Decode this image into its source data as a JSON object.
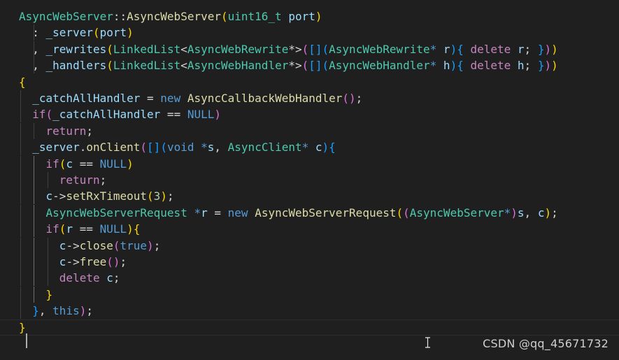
{
  "watermark": "CSDN @qq_45671732",
  "colors": {
    "background": "#1f1f1f",
    "plain": "#d4d4d4",
    "type": "#4ec9b0",
    "function": "#dcdcaa",
    "variable": "#9cdcfe",
    "keyword": "#569cd6",
    "control": "#c586c0",
    "number": "#b5cea8",
    "bracket1": "#ffd700",
    "bracket2": "#da70d6",
    "bracket3": "#179fff"
  },
  "editor": {
    "lines": [
      [
        {
          "t": "AsyncWebServer",
          "c": "type"
        },
        {
          "t": "::",
          "c": "plain"
        },
        {
          "t": "AsyncWebServer",
          "c": "function"
        },
        {
          "t": "(",
          "c": "bracket1"
        },
        {
          "t": "uint16_t",
          "c": "type"
        },
        {
          "t": " ",
          "c": "plain"
        },
        {
          "t": "port",
          "c": "variable"
        },
        {
          "t": ")",
          "c": "bracket1"
        }
      ],
      [
        {
          "t": "  : ",
          "c": "plain"
        },
        {
          "t": "_server",
          "c": "variable"
        },
        {
          "t": "(",
          "c": "bracket1"
        },
        {
          "t": "port",
          "c": "variable"
        },
        {
          "t": ")",
          "c": "bracket1"
        }
      ],
      [
        {
          "t": "  , ",
          "c": "plain"
        },
        {
          "t": "_rewrites",
          "c": "variable"
        },
        {
          "t": "(",
          "c": "bracket1"
        },
        {
          "t": "LinkedList",
          "c": "type"
        },
        {
          "t": "<",
          "c": "plain"
        },
        {
          "t": "AsyncWebRewrite",
          "c": "type"
        },
        {
          "t": "*>",
          "c": "plain"
        },
        {
          "t": "(",
          "c": "bracket2"
        },
        {
          "t": "[]",
          "c": "bracket3"
        },
        {
          "t": "(",
          "c": "bracket3"
        },
        {
          "t": "AsyncWebRewrite",
          "c": "type"
        },
        {
          "t": "*",
          "c": "keyword"
        },
        {
          "t": " r",
          "c": "variable"
        },
        {
          "t": ")",
          "c": "bracket3"
        },
        {
          "t": "{",
          "c": "bracket3"
        },
        {
          "t": " delete",
          "c": "control"
        },
        {
          "t": " r",
          "c": "variable"
        },
        {
          "t": "; ",
          "c": "plain"
        },
        {
          "t": "}",
          "c": "bracket3"
        },
        {
          "t": ")",
          "c": "bracket2"
        },
        {
          "t": ")",
          "c": "bracket1"
        }
      ],
      [
        {
          "t": "  , ",
          "c": "plain"
        },
        {
          "t": "_handlers",
          "c": "variable"
        },
        {
          "t": "(",
          "c": "bracket1"
        },
        {
          "t": "LinkedList",
          "c": "type"
        },
        {
          "t": "<",
          "c": "plain"
        },
        {
          "t": "AsyncWebHandler",
          "c": "type"
        },
        {
          "t": "*>",
          "c": "plain"
        },
        {
          "t": "(",
          "c": "bracket2"
        },
        {
          "t": "[]",
          "c": "bracket3"
        },
        {
          "t": "(",
          "c": "bracket3"
        },
        {
          "t": "AsyncWebHandler",
          "c": "type"
        },
        {
          "t": "*",
          "c": "keyword"
        },
        {
          "t": " h",
          "c": "variable"
        },
        {
          "t": ")",
          "c": "bracket3"
        },
        {
          "t": "{",
          "c": "bracket3"
        },
        {
          "t": " delete",
          "c": "control"
        },
        {
          "t": " h",
          "c": "variable"
        },
        {
          "t": "; ",
          "c": "plain"
        },
        {
          "t": "}",
          "c": "bracket3"
        },
        {
          "t": ")",
          "c": "bracket2"
        },
        {
          "t": ")",
          "c": "bracket1"
        }
      ],
      [
        {
          "t": "{",
          "c": "bracket1"
        }
      ],
      [
        {
          "t": "  ",
          "c": "plain"
        },
        {
          "t": "_catchAllHandler",
          "c": "variable"
        },
        {
          "t": " = ",
          "c": "plain"
        },
        {
          "t": "new",
          "c": "keyword"
        },
        {
          "t": " ",
          "c": "plain"
        },
        {
          "t": "AsyncCallbackWebHandler",
          "c": "function"
        },
        {
          "t": "()",
          "c": "bracket2"
        },
        {
          "t": ";",
          "c": "plain"
        }
      ],
      [
        {
          "t": "  ",
          "c": "plain"
        },
        {
          "t": "if",
          "c": "control"
        },
        {
          "t": "(",
          "c": "bracket2"
        },
        {
          "t": "_catchAllHandler",
          "c": "variable"
        },
        {
          "t": " == ",
          "c": "plain"
        },
        {
          "t": "NULL",
          "c": "keyword"
        },
        {
          "t": ")",
          "c": "bracket2"
        }
      ],
      [
        {
          "t": "    ",
          "c": "plain"
        },
        {
          "t": "return",
          "c": "control"
        },
        {
          "t": ";",
          "c": "plain"
        }
      ],
      [
        {
          "t": "  ",
          "c": "plain"
        },
        {
          "t": "_server",
          "c": "variable"
        },
        {
          "t": ".",
          "c": "plain"
        },
        {
          "t": "onClient",
          "c": "function"
        },
        {
          "t": "(",
          "c": "bracket2"
        },
        {
          "t": "[]",
          "c": "bracket3"
        },
        {
          "t": "(",
          "c": "bracket3"
        },
        {
          "t": "void",
          "c": "keyword"
        },
        {
          "t": " *",
          "c": "keyword"
        },
        {
          "t": "s",
          "c": "variable"
        },
        {
          "t": ", ",
          "c": "plain"
        },
        {
          "t": "AsyncClient",
          "c": "type"
        },
        {
          "t": "*",
          "c": "keyword"
        },
        {
          "t": " c",
          "c": "variable"
        },
        {
          "t": ")",
          "c": "bracket3"
        },
        {
          "t": "{",
          "c": "bracket3"
        }
      ],
      [
        {
          "t": "    ",
          "c": "plain"
        },
        {
          "t": "if",
          "c": "control"
        },
        {
          "t": "(",
          "c": "bracket1"
        },
        {
          "t": "c",
          "c": "variable"
        },
        {
          "t": " == ",
          "c": "plain"
        },
        {
          "t": "NULL",
          "c": "keyword"
        },
        {
          "t": ")",
          "c": "bracket1"
        }
      ],
      [
        {
          "t": "      ",
          "c": "plain"
        },
        {
          "t": "return",
          "c": "control"
        },
        {
          "t": ";",
          "c": "plain"
        }
      ],
      [
        {
          "t": "    ",
          "c": "plain"
        },
        {
          "t": "c",
          "c": "variable"
        },
        {
          "t": "->",
          "c": "plain"
        },
        {
          "t": "setRxTimeout",
          "c": "function"
        },
        {
          "t": "(",
          "c": "bracket1"
        },
        {
          "t": "3",
          "c": "number"
        },
        {
          "t": ")",
          "c": "bracket1"
        },
        {
          "t": ";",
          "c": "plain"
        }
      ],
      [
        {
          "t": "    ",
          "c": "plain"
        },
        {
          "t": "AsyncWebServerRequest",
          "c": "type"
        },
        {
          "t": " *",
          "c": "keyword"
        },
        {
          "t": "r",
          "c": "variable"
        },
        {
          "t": " = ",
          "c": "plain"
        },
        {
          "t": "new",
          "c": "keyword"
        },
        {
          "t": " ",
          "c": "plain"
        },
        {
          "t": "AsyncWebServerRequest",
          "c": "function"
        },
        {
          "t": "(",
          "c": "bracket1"
        },
        {
          "t": "(",
          "c": "bracket2"
        },
        {
          "t": "AsyncWebServer",
          "c": "type"
        },
        {
          "t": "*",
          "c": "keyword"
        },
        {
          "t": ")",
          "c": "bracket2"
        },
        {
          "t": "s",
          "c": "variable"
        },
        {
          "t": ", ",
          "c": "plain"
        },
        {
          "t": "c",
          "c": "variable"
        },
        {
          "t": ")",
          "c": "bracket1"
        },
        {
          "t": ";",
          "c": "plain"
        }
      ],
      [
        {
          "t": "    ",
          "c": "plain"
        },
        {
          "t": "if",
          "c": "control"
        },
        {
          "t": "(",
          "c": "bracket1"
        },
        {
          "t": "r",
          "c": "variable"
        },
        {
          "t": " == ",
          "c": "plain"
        },
        {
          "t": "NULL",
          "c": "keyword"
        },
        {
          "t": ")",
          "c": "bracket1"
        },
        {
          "t": "{",
          "c": "bracket1"
        }
      ],
      [
        {
          "t": "      ",
          "c": "plain"
        },
        {
          "t": "c",
          "c": "variable"
        },
        {
          "t": "->",
          "c": "plain"
        },
        {
          "t": "close",
          "c": "function"
        },
        {
          "t": "(",
          "c": "bracket2"
        },
        {
          "t": "true",
          "c": "keyword"
        },
        {
          "t": ")",
          "c": "bracket2"
        },
        {
          "t": ";",
          "c": "plain"
        }
      ],
      [
        {
          "t": "      ",
          "c": "plain"
        },
        {
          "t": "c",
          "c": "variable"
        },
        {
          "t": "->",
          "c": "plain"
        },
        {
          "t": "free",
          "c": "function"
        },
        {
          "t": "()",
          "c": "bracket2"
        },
        {
          "t": ";",
          "c": "plain"
        }
      ],
      [
        {
          "t": "      ",
          "c": "plain"
        },
        {
          "t": "delete",
          "c": "control"
        },
        {
          "t": " c",
          "c": "variable"
        },
        {
          "t": ";",
          "c": "plain"
        }
      ],
      [
        {
          "t": "    ",
          "c": "plain"
        },
        {
          "t": "}",
          "c": "bracket1"
        }
      ],
      [
        {
          "t": "  ",
          "c": "plain"
        },
        {
          "t": "}",
          "c": "bracket3"
        },
        {
          "t": ", ",
          "c": "plain"
        },
        {
          "t": "this",
          "c": "keyword"
        },
        {
          "t": ")",
          "c": "bracket2"
        },
        {
          "t": ";",
          "c": "plain"
        }
      ],
      [
        {
          "t": "}",
          "c": "bracket1"
        }
      ]
    ]
  }
}
